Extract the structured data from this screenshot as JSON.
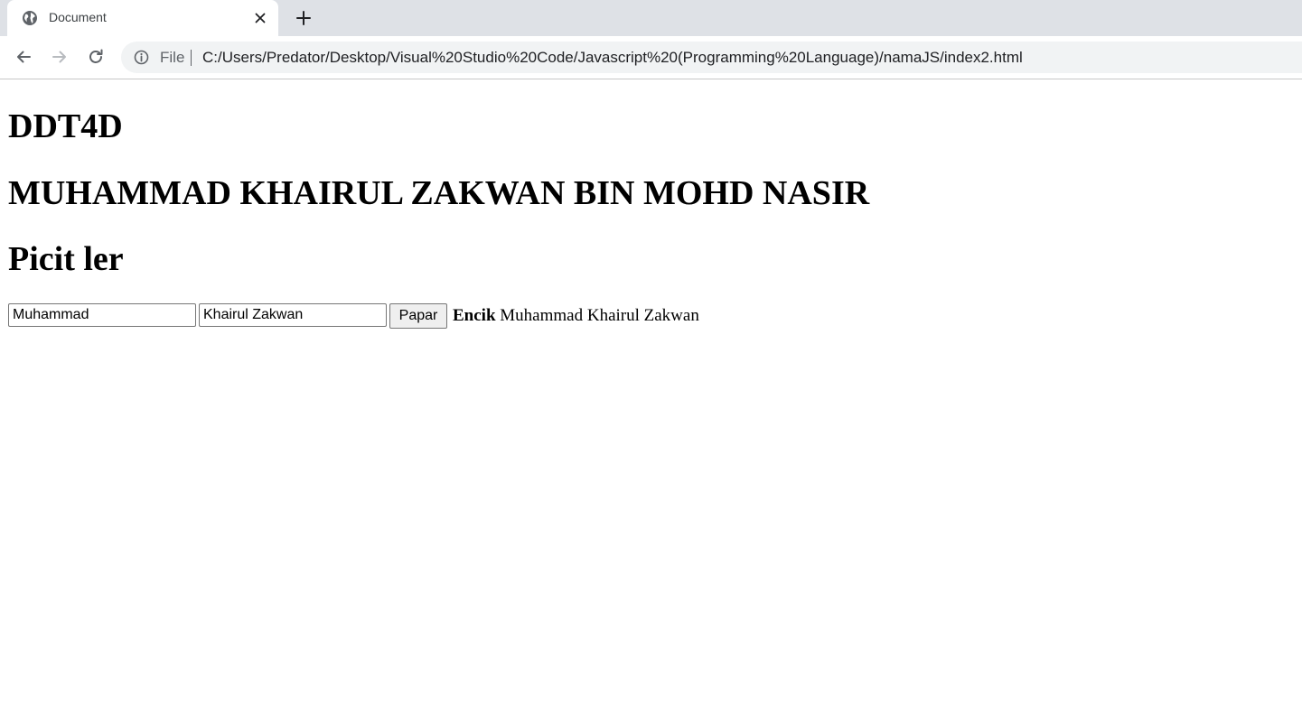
{
  "browser": {
    "tab": {
      "title": "Document",
      "favicon_icon": "globe-icon",
      "close_icon": "close-icon"
    },
    "new_tab_icon": "plus-icon",
    "nav": {
      "back_icon": "arrow-left-icon",
      "forward_icon": "arrow-right-icon",
      "reload_icon": "reload-icon"
    },
    "address_bar": {
      "info_icon": "info-icon",
      "scheme_label": "File",
      "url": "C:/Users/Predator/Desktop/Visual%20Studio%20Code/Javascript%20(Programming%20Language)/namaJS/index2.html"
    }
  },
  "page": {
    "headings": [
      "DDT4D",
      "MUHAMMAD KHAIRUL ZAKWAN BIN MOHD NASIR",
      "Picit ler"
    ],
    "form": {
      "first_name_value": "Muhammad",
      "last_name_value": "Khairul Zakwan",
      "button_label": "Papar"
    },
    "result": {
      "title": "Encik",
      "name": "Muhammad Khairul Zakwan"
    }
  },
  "colors": {
    "tabstrip_bg": "#dee1e6",
    "omnibox_bg": "#f1f3f4",
    "button_bg": "#efefef"
  }
}
